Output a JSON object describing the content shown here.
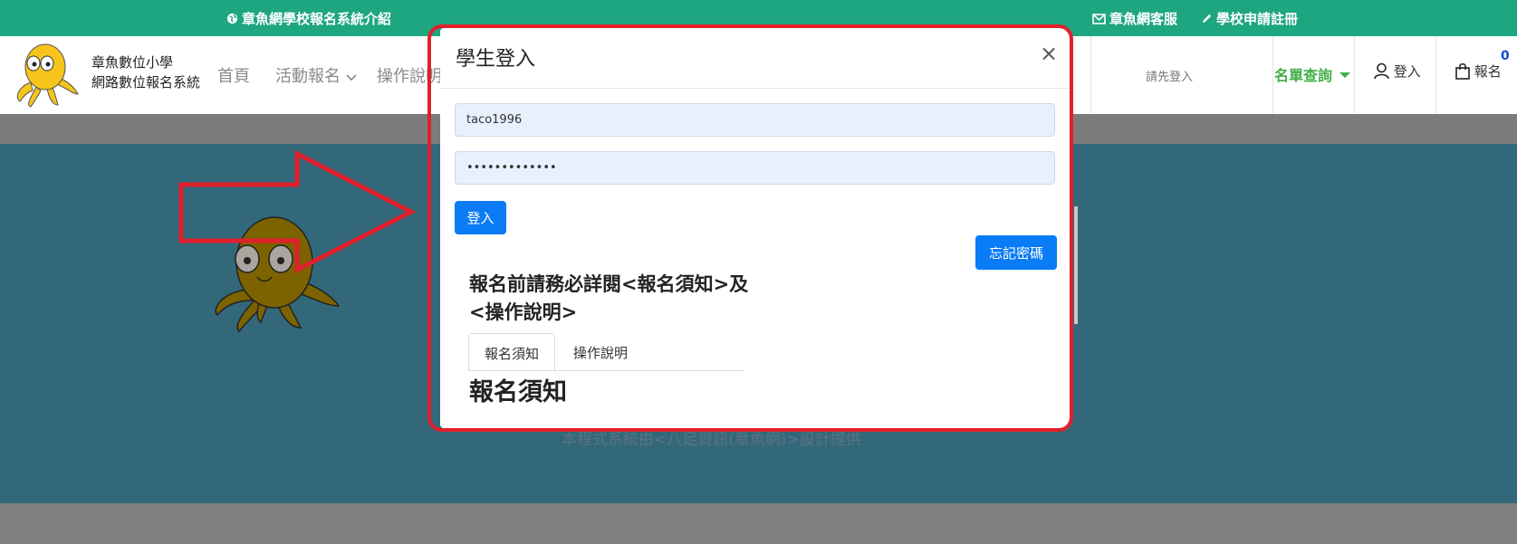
{
  "topbar": {
    "intro_link": "章魚網學校報名系統介紹",
    "service_link": "章魚網客服",
    "register_link": "學校申請註冊"
  },
  "brand": {
    "line1": "章魚數位小學",
    "line2": "網路數位報名系統"
  },
  "nav": {
    "home": "首頁",
    "events": "活動報名",
    "guide": "操作說明",
    "notice": "請先登入",
    "query": "名單查詢",
    "login": "登入",
    "signup": "報名",
    "cart_count": "0"
  },
  "page": {
    "footer_credit": "本程式系統由<八足資訊(章魚網)>設計提供"
  },
  "modal": {
    "title": "學生登入",
    "close": "×",
    "username_value": "taco1996",
    "password_value": "•••••••••••••",
    "login_button": "登入",
    "forgot_button": "忘記密碼",
    "warning": "報名前請務必詳閱<報名須知>及<操作說明>",
    "tabs": [
      "報名須知",
      "操作說明"
    ],
    "section_heading": "報名須知"
  },
  "colors": {
    "topbar": "#1ea680",
    "hero": "#33687a",
    "primary_button": "#0a7cf5",
    "query_green": "#3fae45",
    "highlight_red": "#e0202c"
  }
}
